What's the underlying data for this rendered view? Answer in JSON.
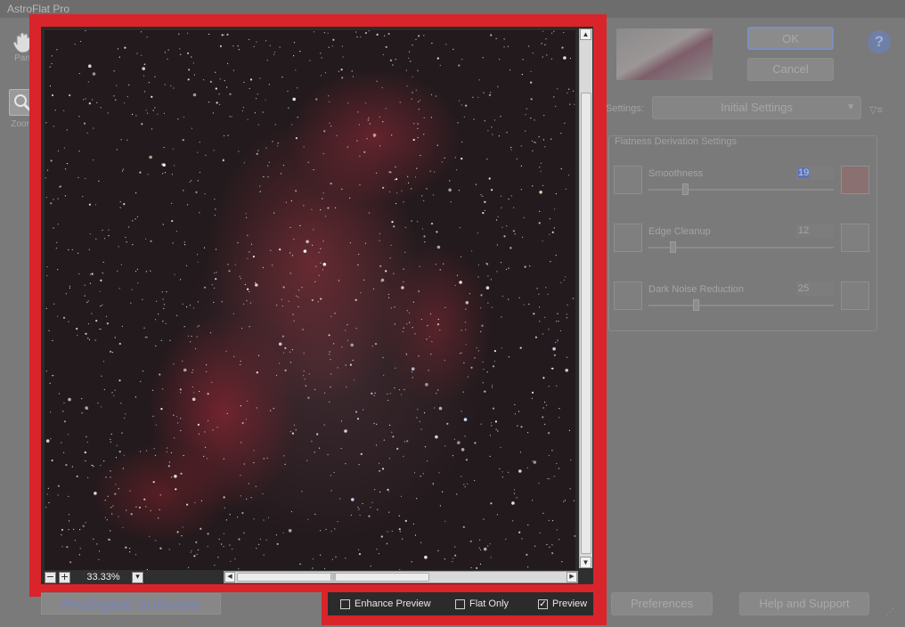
{
  "window": {
    "title": "AstroFlat Pro"
  },
  "tools": [
    {
      "label": "Pan",
      "icon": "hand-icon"
    },
    {
      "label": "Zoom",
      "icon": "magnifier-icon"
    }
  ],
  "viewer": {
    "zoom": "33.33%",
    "zoom_out": "−",
    "zoom_in": "+",
    "zoom_menu": "▾"
  },
  "checkboxes": [
    {
      "label": "Enhance Preview",
      "checked": false
    },
    {
      "label": "Flat Only",
      "checked": false
    },
    {
      "label": "Preview",
      "checked": true
    }
  ],
  "buttons": {
    "ok": "OK",
    "cancel": "Cancel",
    "preferences": "Preferences",
    "help_support": "Help and Support",
    "help_icon": "?"
  },
  "settings": {
    "label": "Settings:",
    "selected": "Initial Settings"
  },
  "group": {
    "title": "Flatness Derivation Settings",
    "rows": [
      {
        "label": "Smoothness",
        "value": "19",
        "level": 0.19
      },
      {
        "label": "Edge Cleanup",
        "value": "12",
        "level": 0.12
      },
      {
        "label": "Dark Noise Reduction",
        "value": "25",
        "level": 0.25
      }
    ]
  },
  "brand": {
    "text": "ProDigital Software"
  },
  "colors": {
    "highlight_frame": "#d8242a",
    "nebula": "#b0303c"
  }
}
